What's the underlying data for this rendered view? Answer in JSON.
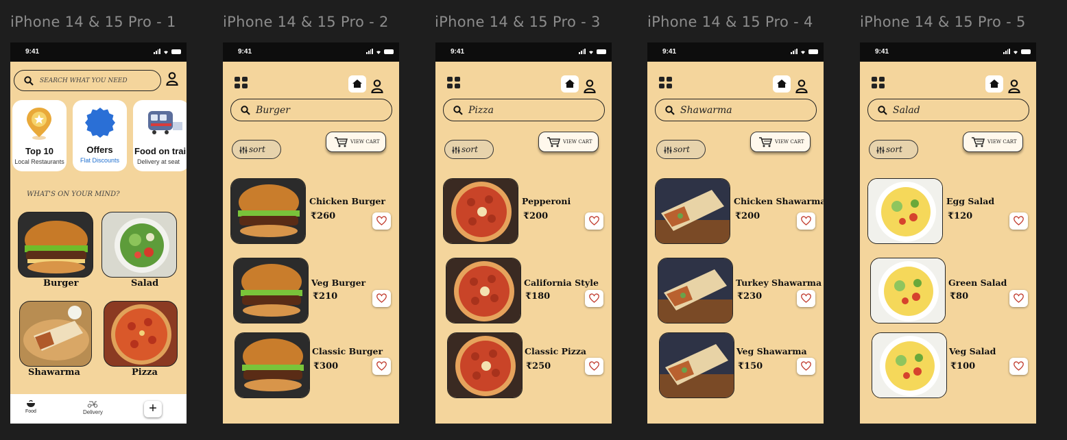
{
  "frames": [
    {
      "title": "iPhone 14 & 15 Pro - 1"
    },
    {
      "title": "iPhone 14 & 15 Pro - 2"
    },
    {
      "title": "iPhone 14 & 15 Pro - 3"
    },
    {
      "title": "iPhone 14 & 15 Pro - 4"
    },
    {
      "title": "iPhone 14 & 15 Pro - 5"
    }
  ],
  "status_time": "9:41",
  "home": {
    "search_placeholder": "SEARCH  WHAT YOU NEED",
    "cards": [
      {
        "title": "Top 10",
        "subtitle": "Local Restaurants"
      },
      {
        "title": "Offers",
        "subtitle": "Flat Discounts"
      },
      {
        "title": "Food on train",
        "subtitle": "Delivery at seat"
      }
    ],
    "section_title": "WHAT'S ON YOUR MIND?",
    "tiles": [
      {
        "label": "Burger"
      },
      {
        "label": "Salad"
      },
      {
        "label": "Shawarma"
      },
      {
        "label": "Pizza"
      }
    ],
    "nav": {
      "food": "Food",
      "delivery": "Delivery",
      "plus": "+"
    }
  },
  "sort_label": "sort",
  "cart_label": "VIEW CART",
  "lists": [
    {
      "search": "Burger",
      "items": [
        {
          "name": "Chicken Burger",
          "price": "₹260"
        },
        {
          "name": "Veg Burger",
          "price": "₹210"
        },
        {
          "name": "Classic Burger",
          "price": "₹300"
        }
      ]
    },
    {
      "search": "Pizza",
      "items": [
        {
          "name": "Pepperoni",
          "price": "₹200"
        },
        {
          "name": "California Style",
          "price": "₹180"
        },
        {
          "name": "Classic Pizza",
          "price": "₹250"
        }
      ]
    },
    {
      "search": "Shawarma",
      "items": [
        {
          "name": "Chicken Shawarma",
          "price": "₹200"
        },
        {
          "name": "Turkey Shawarma",
          "price": "₹230"
        },
        {
          "name": "Veg Shawarma",
          "price": "₹150"
        }
      ]
    },
    {
      "search": "Salad",
      "items": [
        {
          "name": "Egg Salad",
          "price": "₹120"
        },
        {
          "name": "Green Salad",
          "price": "₹80"
        },
        {
          "name": "Veg Salad",
          "price": "₹100"
        }
      ]
    }
  ],
  "colors": {
    "background": "#1e1e1e",
    "phone": "#f4d59c",
    "heart": "#c0392b",
    "accent_blue": "#1e6fd0"
  }
}
